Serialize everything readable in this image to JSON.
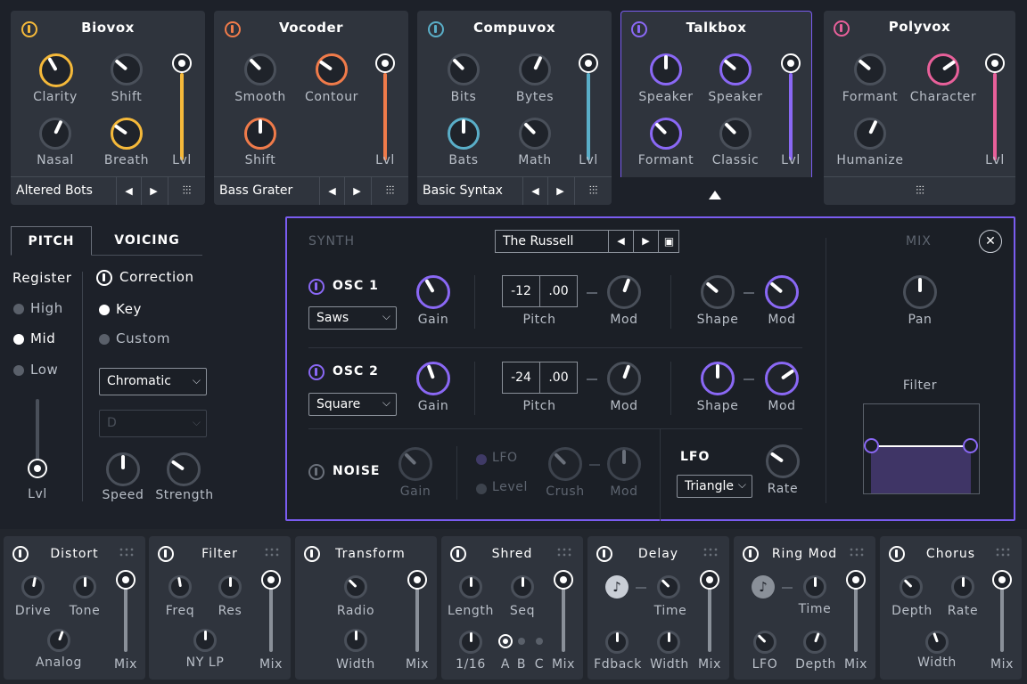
{
  "top_modules": [
    {
      "title": "Biovox",
      "accent": "#f5b93a",
      "knobs": [
        "Clarity",
        "Shift",
        "Nasal",
        "Breath"
      ],
      "slider_label": "Lvl",
      "preset": "Altered Bots"
    },
    {
      "title": "Vocoder",
      "accent": "#f07b4a",
      "knobs": [
        "Smooth",
        "Contour",
        "Shift"
      ],
      "slider_label": "Lvl",
      "preset": "Bass Grater"
    },
    {
      "title": "Compuvox",
      "accent": "#5aaec8",
      "knobs": [
        "Bits",
        "Bytes",
        "Bats",
        "Math"
      ],
      "slider_label": "Lvl",
      "preset": "Basic Syntax"
    },
    {
      "title": "Talkbox",
      "accent": "#8a68f5",
      "knobs": [
        "Speaker",
        "Speaker",
        "Formant",
        "Classic"
      ],
      "slider_label": "Lvl"
    },
    {
      "title": "Polyvox",
      "accent": "#e8609a",
      "knobs": [
        "Formant",
        "Character",
        "Humanize"
      ],
      "slider_label": "Lvl"
    }
  ],
  "left_panel": {
    "tabs": [
      "PITCH",
      "VOICING"
    ],
    "register_label": "Register",
    "register_options": [
      "High",
      "Mid",
      "Low"
    ],
    "correction_label": "Correction",
    "correction_options": [
      "Key",
      "Custom"
    ],
    "scale_value": "Chromatic",
    "key_value": "D",
    "lvl_label": "Lvl",
    "speed_label": "Speed",
    "strength_label": "Strength"
  },
  "synth": {
    "header": "SYNTH",
    "preset": "The Russell",
    "mix_header": "MIX",
    "osc1": {
      "title": "OSC 1",
      "wave": "Saws",
      "gain": "Gain",
      "pitch_semi": "-12",
      "pitch_fine": ".00",
      "pitch": "Pitch",
      "mod": "Mod",
      "shape": "Shape",
      "mod2": "Mod"
    },
    "osc2": {
      "title": "OSC 2",
      "wave": "Square",
      "gain": "Gain",
      "pitch_semi": "-24",
      "pitch_fine": ".00",
      "pitch": "Pitch",
      "mod": "Mod",
      "shape": "Shape",
      "mod2": "Mod"
    },
    "noise": {
      "title": "NOISE",
      "gain": "Gain",
      "lfo": "LFO",
      "level": "Level",
      "crush": "Crush",
      "mod": "Mod"
    },
    "lfo": {
      "title": "LFO",
      "wave": "Triangle",
      "rate": "Rate"
    },
    "pan": "Pan",
    "filter": "Filter"
  },
  "bottom_modules": [
    {
      "title": "Distort",
      "labels": [
        "Drive",
        "Tone",
        "Analog",
        "Mix"
      ]
    },
    {
      "title": "Filter",
      "labels": [
        "Freq",
        "Res",
        "NY LP",
        "Mix"
      ]
    },
    {
      "title": "Transform",
      "labels": [
        "Radio",
        "Width",
        "Mix"
      ]
    },
    {
      "title": "Shred",
      "labels": [
        "Length",
        "Seq",
        "1/16",
        "A",
        "B",
        "C",
        "Mix"
      ]
    },
    {
      "title": "Delay",
      "labels": [
        "Time",
        "Fdback",
        "Width",
        "Mix"
      ]
    },
    {
      "title": "Ring Mod",
      "labels": [
        "Time",
        "LFO",
        "Depth",
        "Mix"
      ]
    },
    {
      "title": "Chorus",
      "labels": [
        "Depth",
        "Rate",
        "Width",
        "Mix"
      ]
    }
  ],
  "colors": {
    "accent_purple": "#7a5cf0",
    "panel": "#2f343d",
    "bg": "#1d2129"
  }
}
